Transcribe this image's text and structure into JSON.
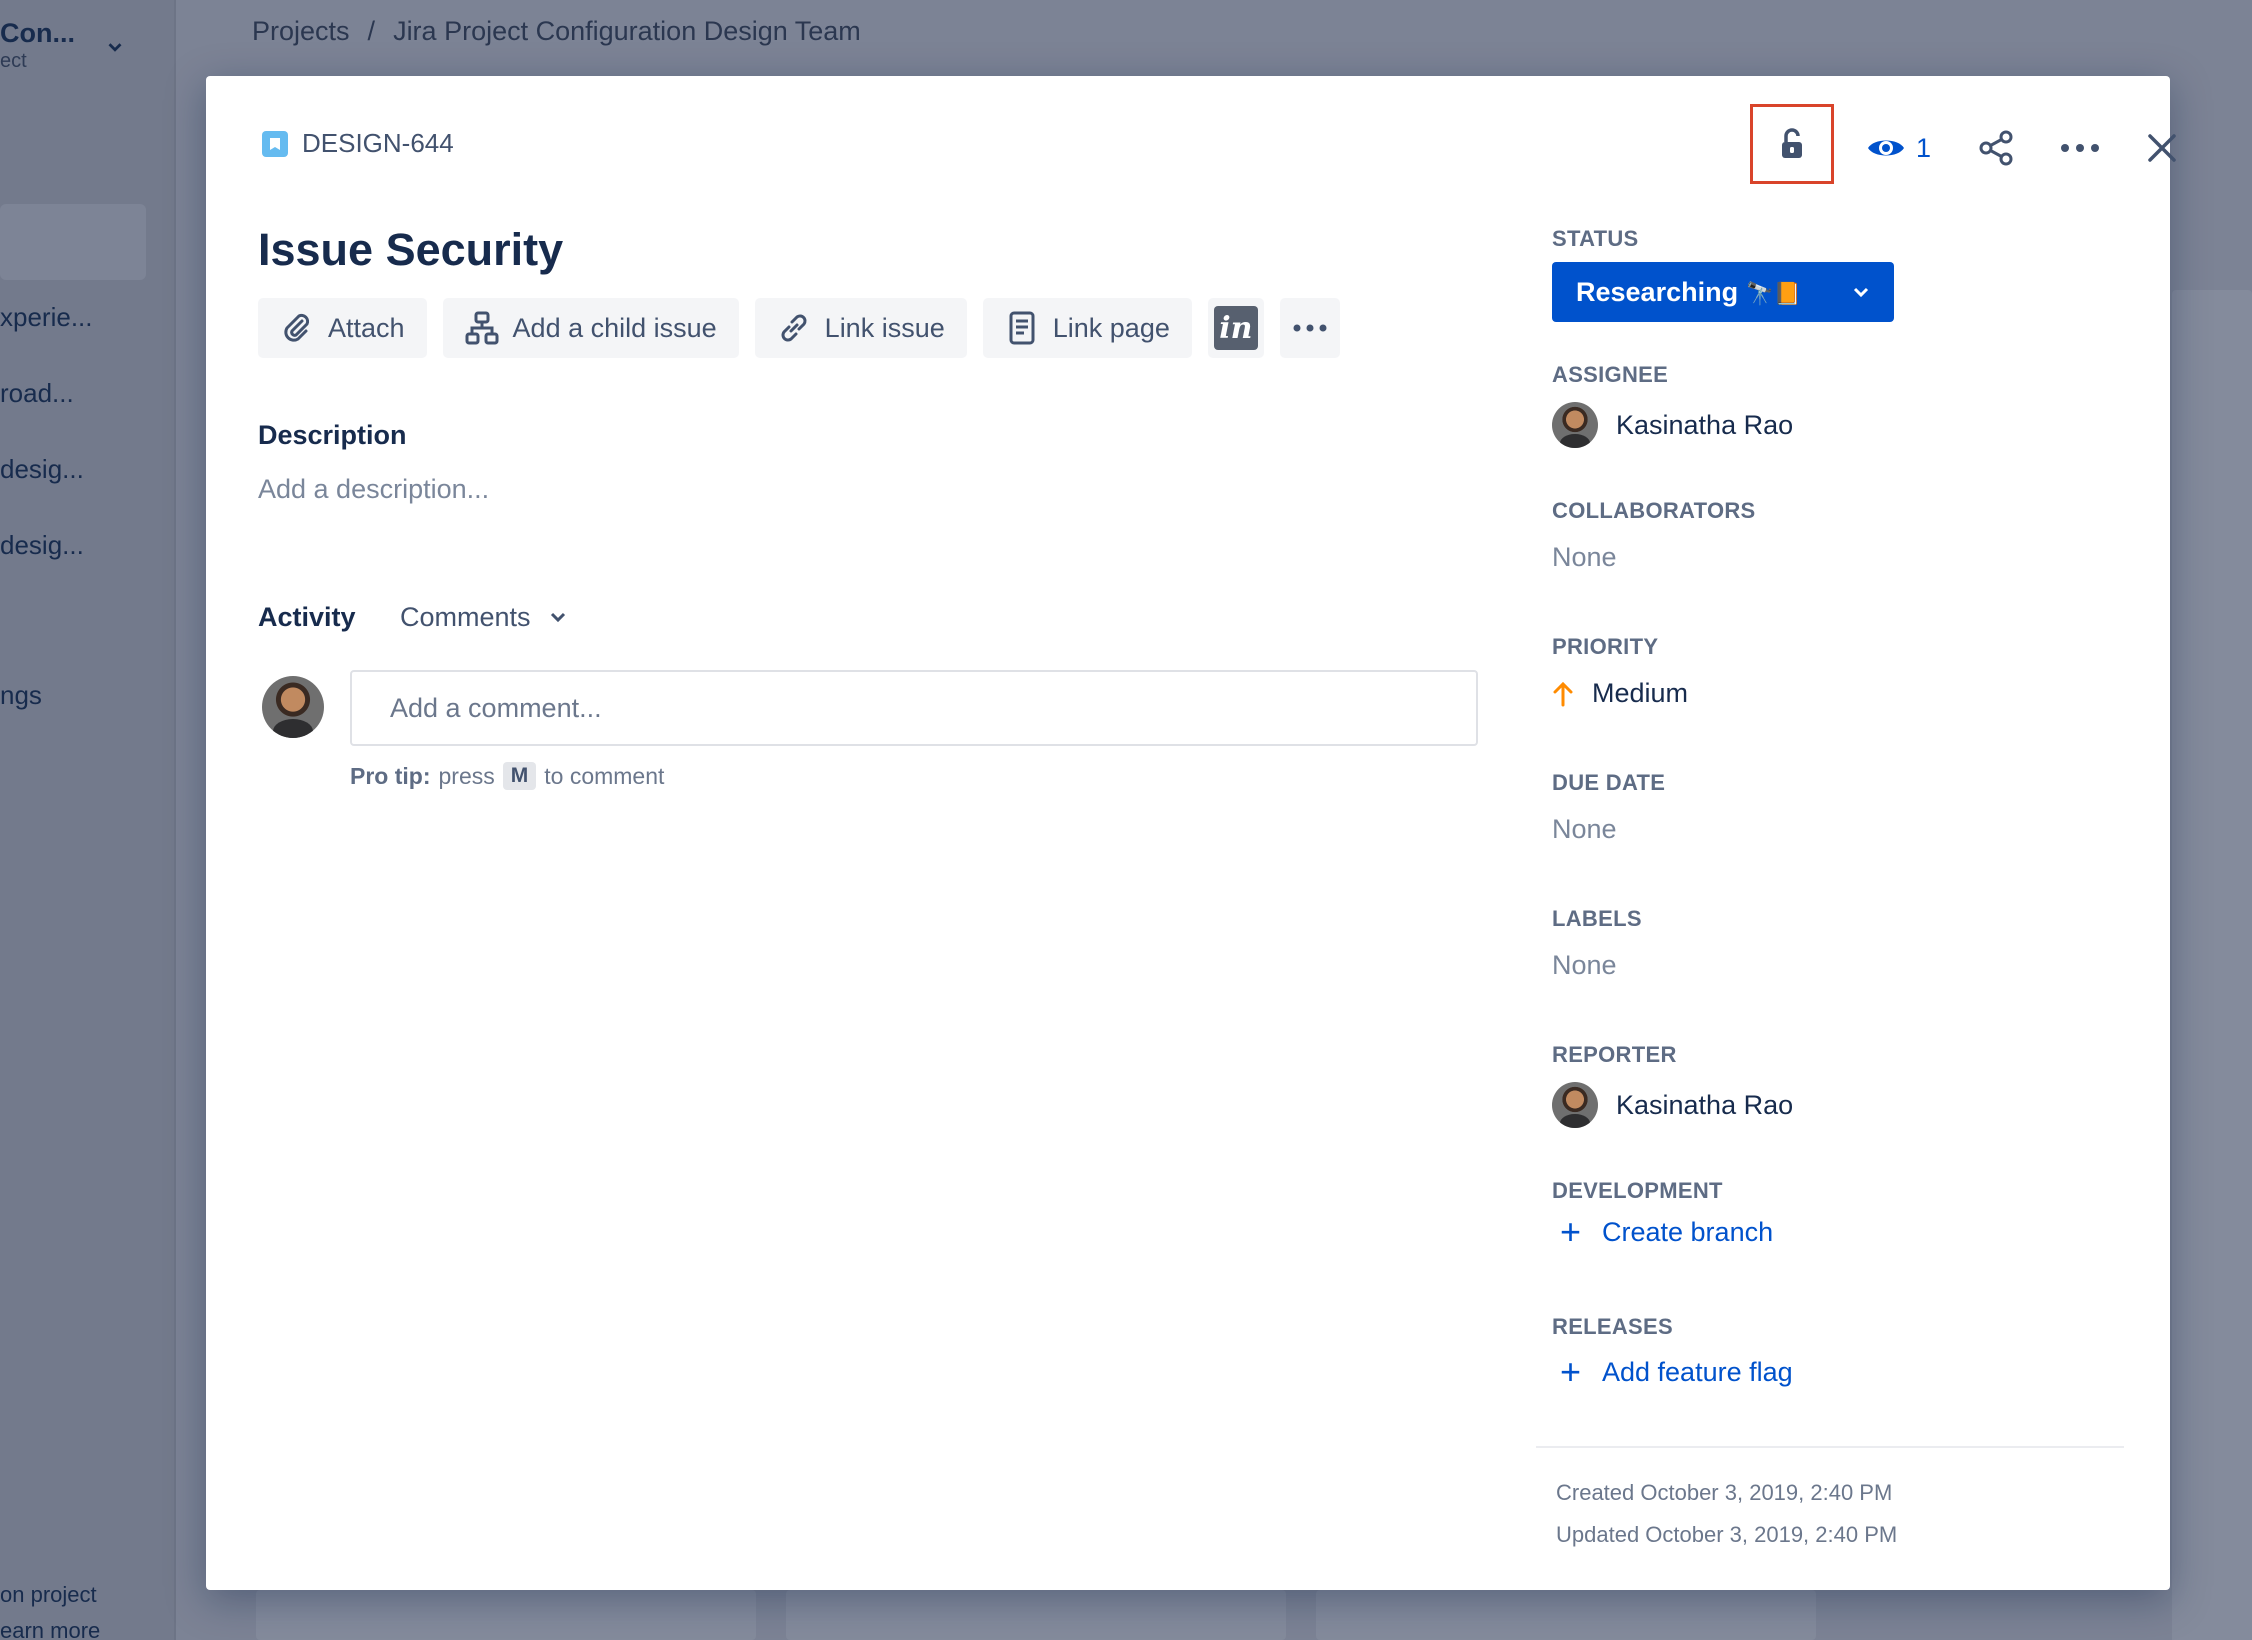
{
  "background": {
    "project_name": "Con...",
    "project_sub": "ect",
    "nav_items": [
      "xperie...",
      "road...",
      "desig...",
      "desig...",
      "ngs"
    ],
    "footer_items": [
      "on project",
      "earn more"
    ],
    "breadcrumb": [
      "Projects",
      "Jira Project Configuration Design Team"
    ]
  },
  "issue": {
    "key": "DESIGN-644",
    "title": "Issue Security",
    "watch_count": "1"
  },
  "toolbar": {
    "attach": "Attach",
    "add_child": "Add a child issue",
    "link_issue": "Link issue",
    "link_page": "Link page",
    "invision": "in"
  },
  "description": {
    "label": "Description",
    "placeholder": "Add a description..."
  },
  "activity": {
    "label": "Activity",
    "filter": "Comments",
    "comment_placeholder": "Add a comment...",
    "protip_bold": "Pro tip:",
    "protip_press": "press",
    "protip_key": "M",
    "protip_rest": "to comment"
  },
  "fields": {
    "status_label": "STATUS",
    "status_value": "Researching",
    "status_emoji": "🔭📙",
    "assignee_label": "ASSIGNEE",
    "assignee_value": "Kasinatha Rao",
    "collaborators_label": "COLLABORATORS",
    "collaborators_value": "None",
    "priority_label": "PRIORITY",
    "priority_value": "Medium",
    "due_date_label": "DUE DATE",
    "due_date_value": "None",
    "labels_label": "LABELS",
    "labels_value": "None",
    "reporter_label": "REPORTER",
    "reporter_value": "Kasinatha Rao",
    "development_label": "DEVELOPMENT",
    "development_value": "Create branch",
    "releases_label": "RELEASES",
    "releases_value": "Add feature flag"
  },
  "meta": {
    "created": "Created October 3, 2019, 2:40 PM",
    "updated": "Updated October 3, 2019, 2:40 PM"
  },
  "colors": {
    "primary": "#0052cc",
    "highlight_border": "#d9442a",
    "priority_medium": "#ff8b00",
    "story_icon": "#65bbf0"
  }
}
